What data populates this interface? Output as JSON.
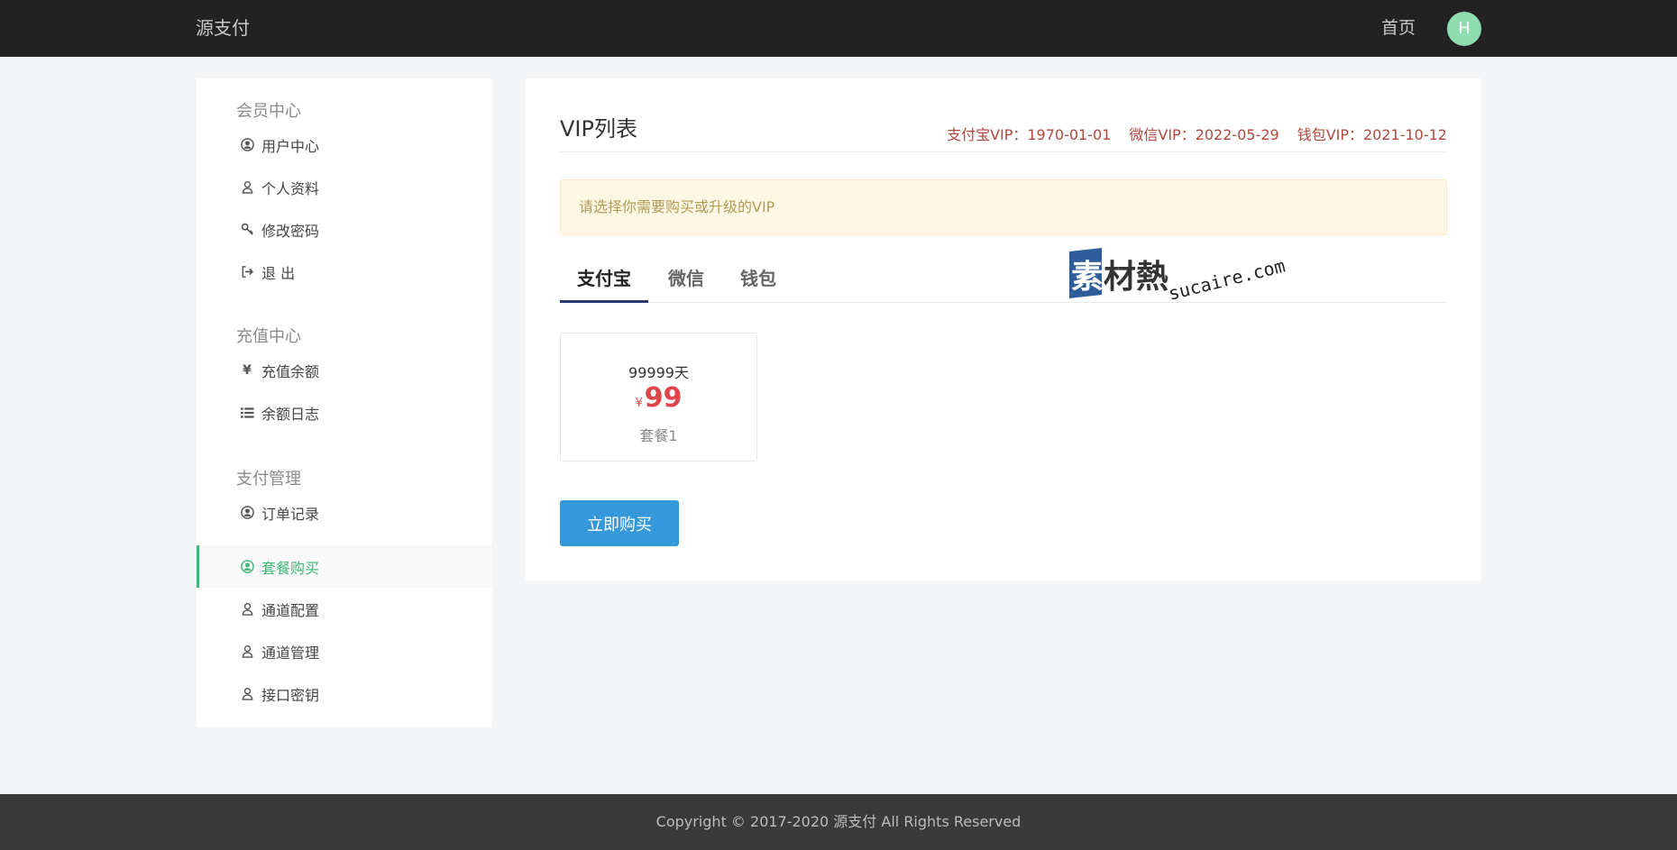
{
  "header": {
    "brand": "源支付",
    "nav_home": "首页",
    "avatar_letter": "H"
  },
  "sidebar": {
    "groups": [
      {
        "title": "会员中心",
        "items": [
          {
            "label": "用户中心",
            "icon": "user-circle-icon"
          },
          {
            "label": "个人资料",
            "icon": "user-outline-icon"
          },
          {
            "label": "修改密码",
            "icon": "key-icon"
          },
          {
            "label": "退 出",
            "icon": "sign-out-icon"
          }
        ]
      },
      {
        "title": "充值中心",
        "items": [
          {
            "label": "充值余额",
            "icon": "yen-icon"
          },
          {
            "label": "余额日志",
            "icon": "list-icon"
          }
        ]
      },
      {
        "title": "支付管理",
        "items": [
          {
            "label": "订单记录",
            "icon": "user-circle-icon"
          },
          {
            "label": "套餐购买",
            "icon": "user-circle-icon",
            "active": true
          },
          {
            "label": "通道配置",
            "icon": "user-outline-icon"
          },
          {
            "label": "通道管理",
            "icon": "user-outline-icon"
          },
          {
            "label": "接口密钥",
            "icon": "user-outline-icon"
          }
        ]
      }
    ]
  },
  "main": {
    "title": "VIP列表",
    "vip_status": [
      "支付宝VIP：1970-01-01",
      "微信VIP：2022-05-29",
      "钱包VIP：2021-10-12"
    ],
    "alert": "请选择你需要购买或升级的VIP",
    "tabs": [
      {
        "label": "支付宝",
        "active": true
      },
      {
        "label": "微信"
      },
      {
        "label": "钱包"
      }
    ],
    "watermark": {
      "cn": "素材熱",
      "en": "sucaire.com"
    },
    "plan": {
      "days": "99999天",
      "currency": "¥",
      "price": "99",
      "name": "套餐1"
    },
    "buy_button": "立即购买"
  },
  "footer": {
    "copyright": "Copyright © 2017-2020 源支付 All Rights Reserved"
  },
  "colors": {
    "accent_green": "#3fb876",
    "price_red": "#e0454c",
    "button_blue": "#3498db",
    "vip_status_red": "#b0483d"
  }
}
